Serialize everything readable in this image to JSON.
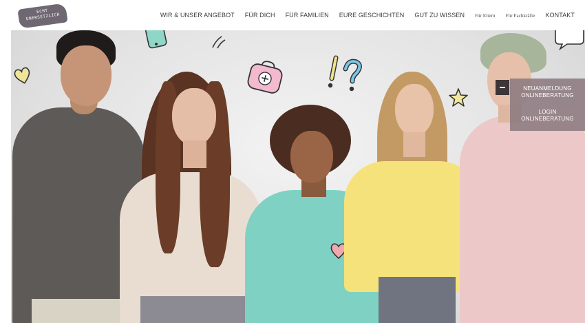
{
  "logo": {
    "line1": "ECHT",
    "line2": "UNERSETZLICH"
  },
  "nav": {
    "items": [
      {
        "label": "WIR & UNSER ANGEBOT",
        "size": "normal"
      },
      {
        "label": "FÜR DICH",
        "size": "normal"
      },
      {
        "label": "FÜR FAMILIEN",
        "size": "normal"
      },
      {
        "label": "EURE GESCHICHTEN",
        "size": "normal"
      },
      {
        "label": "GUT ZU WISSEN",
        "size": "normal"
      },
      {
        "label": "Für Eltern",
        "size": "small"
      },
      {
        "label": "Für Fachkräfte",
        "size": "small"
      },
      {
        "label": "KONTAKT",
        "size": "normal"
      }
    ]
  },
  "side_panel": {
    "new_registration_line1": "NEUANMELDUNG",
    "new_registration_line2": "ONLINEBERATUNG",
    "login_line1": "LOGIN",
    "login_line2": "ONLINEBERATUNG",
    "toggle_icon": "minus-icon"
  },
  "hero": {
    "doodles": [
      "heart-icon",
      "phone-icon",
      "speed-lines-icon",
      "first-aid-kit-icon",
      "exclamation-mark-icon",
      "question-mark-icon",
      "star-icon",
      "speech-bubble-icon",
      "heart-print-icon"
    ],
    "colors": {
      "shirt_dark_gray": "#5d5a57",
      "sweater_beige": "#e9ddd2",
      "shirt_mint": "#7fd2c3",
      "shirt_yellow": "#f6e27a",
      "hoodie_pink": "#ecc8c8",
      "panel_mauve": "#8c7a80"
    }
  }
}
